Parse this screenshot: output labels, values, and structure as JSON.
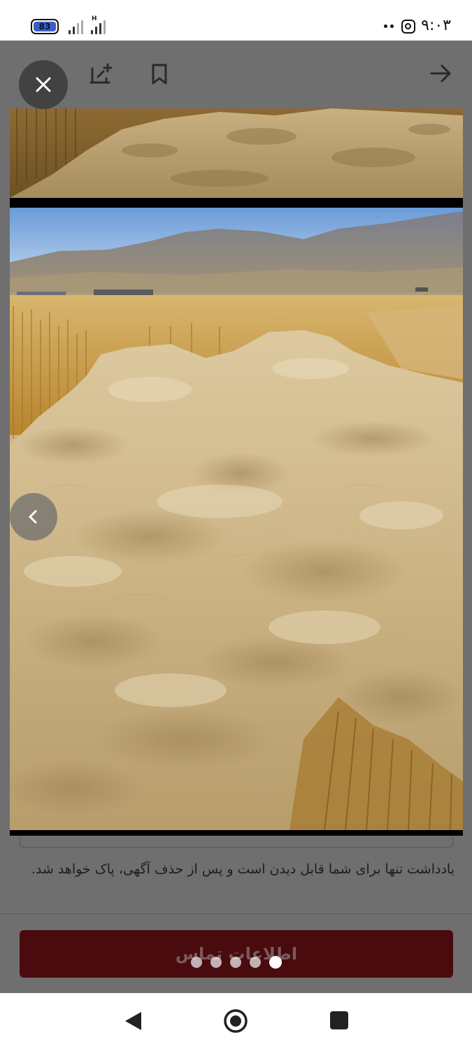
{
  "status_bar": {
    "battery_level": "83",
    "network_indicator": "H",
    "time": "۹:۰۳",
    "icons": [
      "battery-icon",
      "signal-icon",
      "signal-icon",
      "more-dots-icon",
      "instagram-icon"
    ]
  },
  "toolbar": {
    "icons": [
      "close-icon",
      "add-note-icon",
      "bookmark-icon",
      "back-arrow-icon"
    ]
  },
  "gallery": {
    "current_index": 5,
    "total": 5,
    "photo_description_names": [
      "straw-field-photo-top",
      "straw-pile-photo"
    ],
    "prev_icon": "chevron-left-icon"
  },
  "note": {
    "text": "یادداشت تنها برای شما قابل دیدن است و پس از حذف آگهی، پاک خواهد شد."
  },
  "contact": {
    "label": "اطلاعات تماس"
  },
  "navbar": {
    "icons": [
      "nav-back-icon",
      "nav-home-icon",
      "nav-recents-icon"
    ]
  },
  "colors": {
    "contact_button": "#4a0b0e",
    "overlay": "#6f6f6f",
    "battery": "#3b5ccc"
  }
}
